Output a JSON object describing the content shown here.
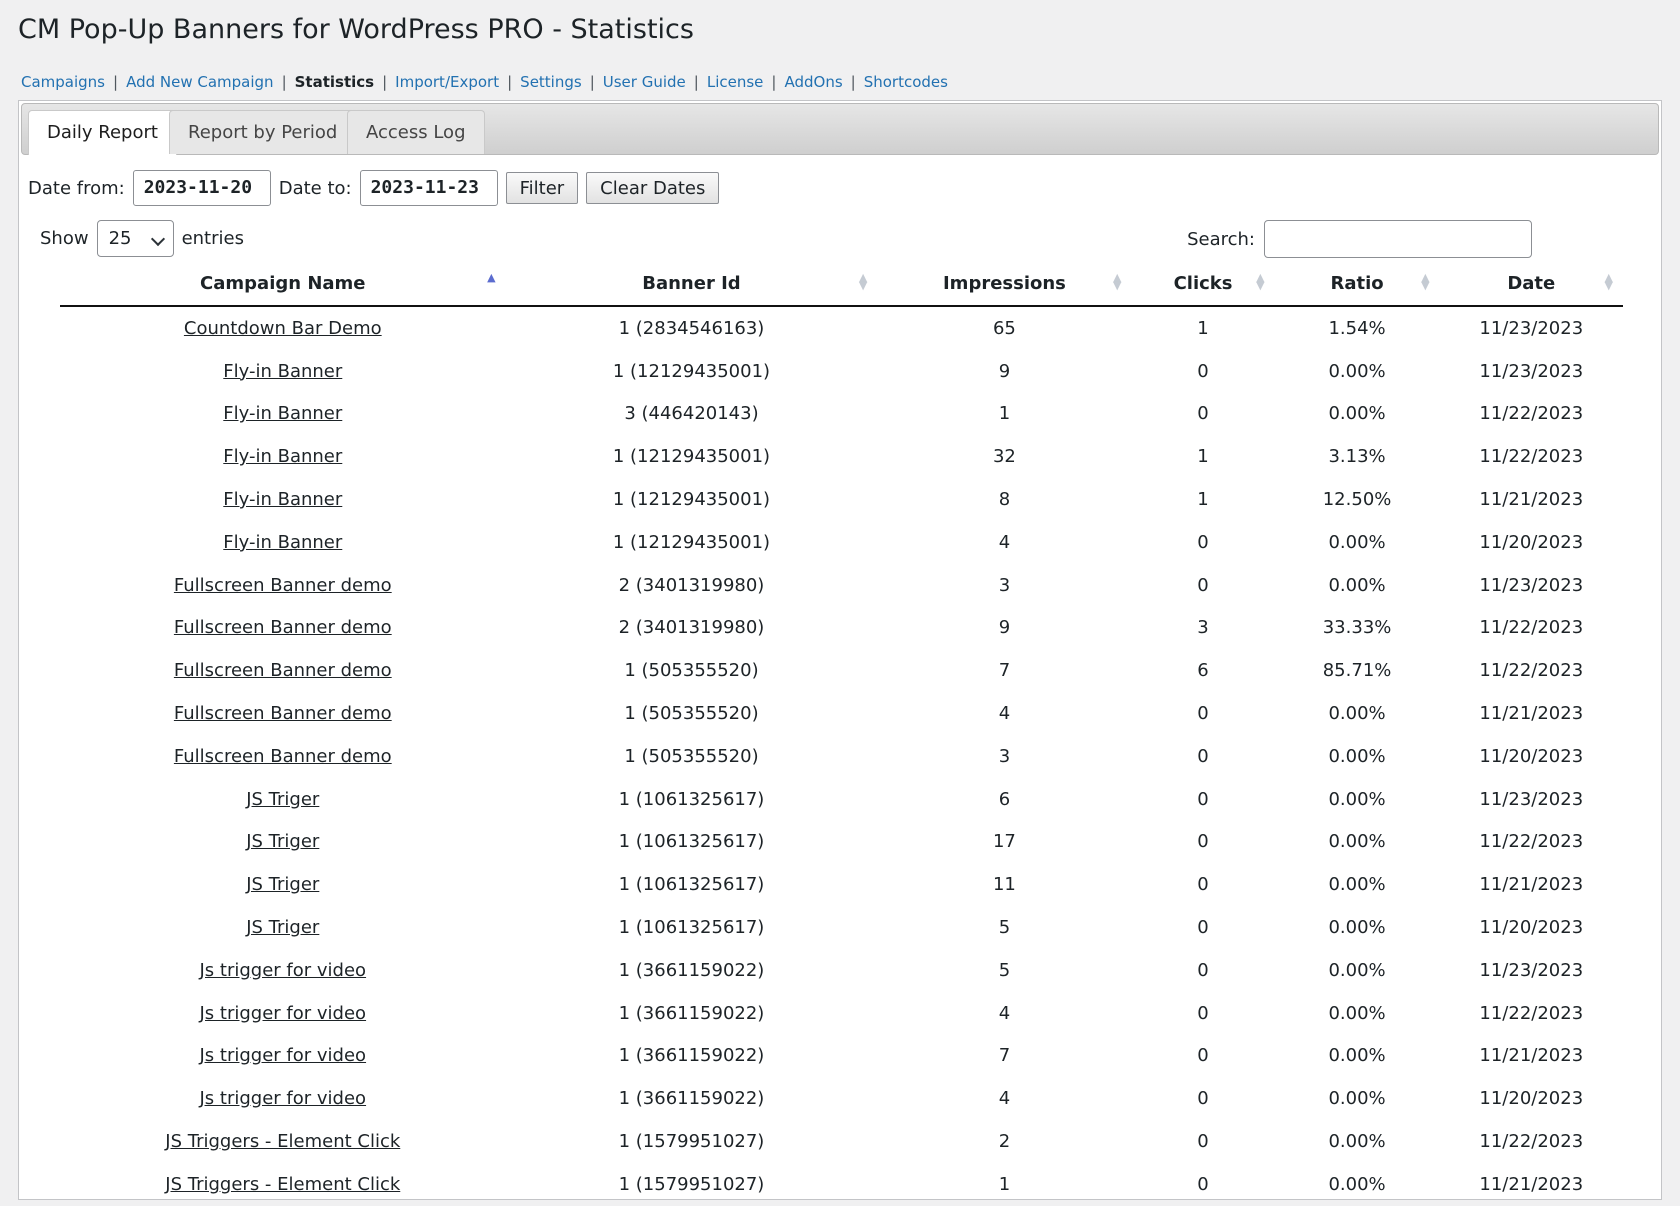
{
  "page_title": "CM Pop-Up Banners for WordPress PRO - Statistics",
  "subnav": [
    {
      "label": "Campaigns",
      "current": false
    },
    {
      "label": "Add New Campaign",
      "current": false
    },
    {
      "label": "Statistics",
      "current": true
    },
    {
      "label": "Import/Export",
      "current": false
    },
    {
      "label": "Settings",
      "current": false
    },
    {
      "label": "User Guide",
      "current": false
    },
    {
      "label": "License",
      "current": false
    },
    {
      "label": "AddOns",
      "current": false
    },
    {
      "label": "Shortcodes",
      "current": false
    }
  ],
  "tabs": [
    {
      "label": "Daily Report",
      "active": true
    },
    {
      "label": "Report by Period",
      "active": false
    },
    {
      "label": "Access Log",
      "active": false
    }
  ],
  "filter": {
    "date_from_label": "Date from:",
    "date_from_value": "2023-11-20",
    "date_to_label": "Date to:",
    "date_to_value": "2023-11-23",
    "filter_button": "Filter",
    "clear_button": "Clear Dates"
  },
  "length": {
    "show_label": "Show",
    "value": "25",
    "entries_label": "entries"
  },
  "search": {
    "label": "Search:",
    "value": ""
  },
  "table": {
    "columns": [
      "Campaign Name",
      "Banner Id",
      "Impressions",
      "Clicks",
      "Ratio",
      "Date"
    ],
    "sorted_column": 0,
    "rows": [
      [
        "Countdown Bar Demo",
        "1 (2834546163)",
        "65",
        "1",
        "1.54%",
        "11/23/2023"
      ],
      [
        "Fly-in Banner",
        "1 (12129435001)",
        "9",
        "0",
        "0.00%",
        "11/23/2023"
      ],
      [
        "Fly-in Banner",
        "3 (446420143)",
        "1",
        "0",
        "0.00%",
        "11/22/2023"
      ],
      [
        "Fly-in Banner",
        "1 (12129435001)",
        "32",
        "1",
        "3.13%",
        "11/22/2023"
      ],
      [
        "Fly-in Banner",
        "1 (12129435001)",
        "8",
        "1",
        "12.50%",
        "11/21/2023"
      ],
      [
        "Fly-in Banner",
        "1 (12129435001)",
        "4",
        "0",
        "0.00%",
        "11/20/2023"
      ],
      [
        "Fullscreen Banner demo",
        "2 (3401319980)",
        "3",
        "0",
        "0.00%",
        "11/23/2023"
      ],
      [
        "Fullscreen Banner demo",
        "2 (3401319980)",
        "9",
        "3",
        "33.33%",
        "11/22/2023"
      ],
      [
        "Fullscreen Banner demo",
        "1 (505355520)",
        "7",
        "6",
        "85.71%",
        "11/22/2023"
      ],
      [
        "Fullscreen Banner demo",
        "1 (505355520)",
        "4",
        "0",
        "0.00%",
        "11/21/2023"
      ],
      [
        "Fullscreen Banner demo",
        "1 (505355520)",
        "3",
        "0",
        "0.00%",
        "11/20/2023"
      ],
      [
        "JS Triger",
        "1 (1061325617)",
        "6",
        "0",
        "0.00%",
        "11/23/2023"
      ],
      [
        "JS Triger",
        "1 (1061325617)",
        "17",
        "0",
        "0.00%",
        "11/22/2023"
      ],
      [
        "JS Triger",
        "1 (1061325617)",
        "11",
        "0",
        "0.00%",
        "11/21/2023"
      ],
      [
        "JS Triger",
        "1 (1061325617)",
        "5",
        "0",
        "0.00%",
        "11/20/2023"
      ],
      [
        "Js trigger for video",
        "1 (3661159022)",
        "5",
        "0",
        "0.00%",
        "11/23/2023"
      ],
      [
        "Js trigger for video",
        "1 (3661159022)",
        "4",
        "0",
        "0.00%",
        "11/22/2023"
      ],
      [
        "Js trigger for video",
        "1 (3661159022)",
        "7",
        "0",
        "0.00%",
        "11/21/2023"
      ],
      [
        "Js trigger for video",
        "1 (3661159022)",
        "4",
        "0",
        "0.00%",
        "11/20/2023"
      ],
      [
        "JS Triggers - Element Click",
        "1 (1579951027)",
        "2",
        "0",
        "0.00%",
        "11/22/2023"
      ],
      [
        "JS Triggers - Element Click",
        "1 (1579951027)",
        "1",
        "0",
        "0.00%",
        "11/21/2023"
      ]
    ]
  },
  "icons": {
    "sort": "sort-arrows-icon",
    "sort_asc": "sort-asc-icon",
    "select": "chevron-down-icon"
  },
  "colors": {
    "link": "#2271b1",
    "background": "#f0f0f1",
    "sort_active": "#5b6ccf"
  }
}
